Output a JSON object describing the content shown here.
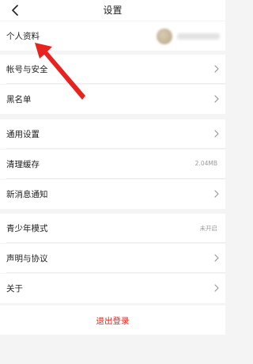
{
  "header": {
    "title": "设置",
    "back_icon": "back-arrow-icon"
  },
  "groups": [
    {
      "items": [
        {
          "label": "个人资料",
          "value": "",
          "has_avatar": true,
          "chevron": false
        }
      ]
    },
    {
      "items": [
        {
          "label": "帐号与安全",
          "value": "",
          "chevron": true
        },
        {
          "label": "黑名单",
          "value": "",
          "chevron": true
        }
      ]
    },
    {
      "items": [
        {
          "label": "通用设置",
          "value": "",
          "chevron": true
        },
        {
          "label": "清理缓存",
          "value": "2.04MB",
          "chevron": false
        },
        {
          "label": "新消息通知",
          "value": "",
          "chevron": true
        }
      ]
    },
    {
      "items": [
        {
          "label": "青少年模式",
          "value": "未开启",
          "chevron": false
        },
        {
          "label": "声明与协议",
          "value": "",
          "chevron": true
        },
        {
          "label": "关于",
          "value": "",
          "chevron": true
        }
      ]
    }
  ],
  "logout": {
    "label": "退出登录",
    "color": "#e2231a"
  },
  "annotation": {
    "arrow_color": "#e8231f"
  }
}
